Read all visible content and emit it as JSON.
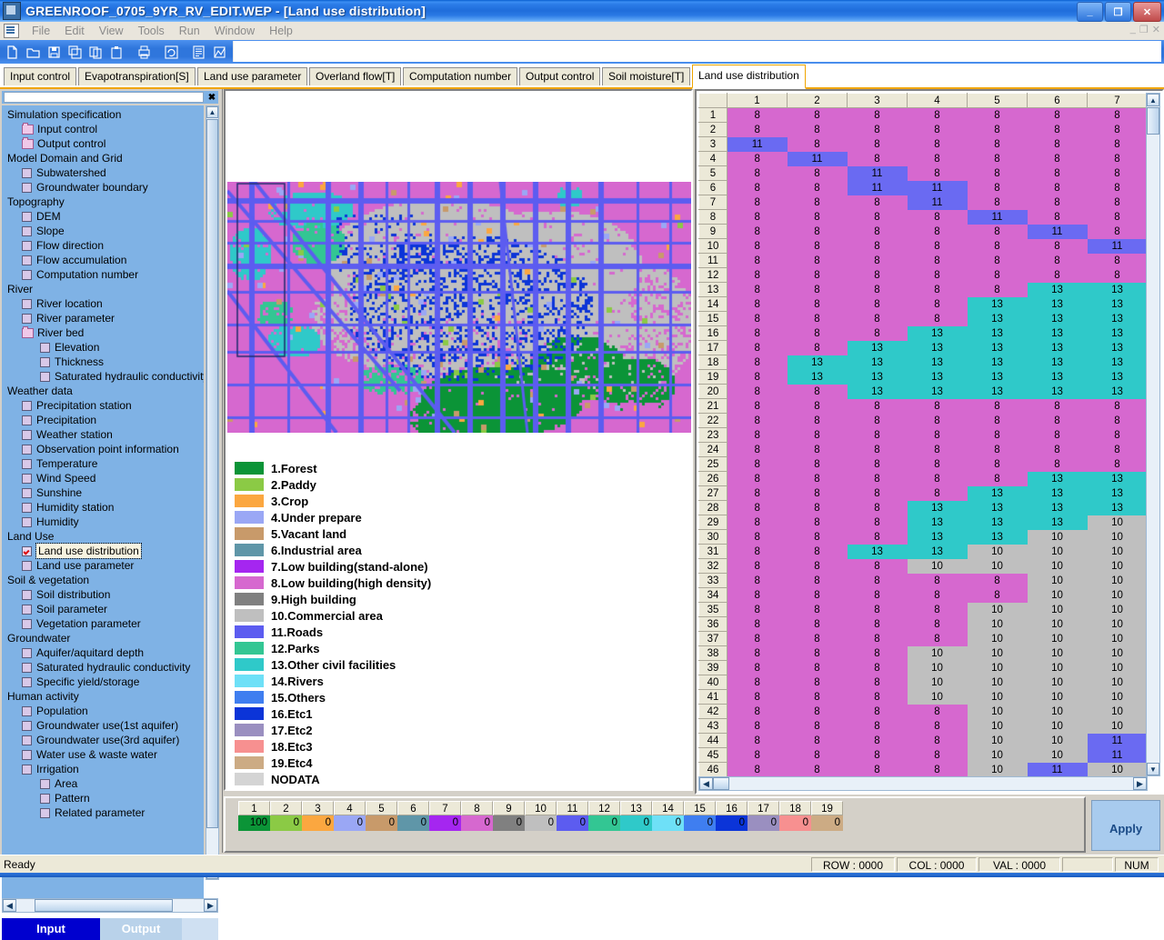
{
  "window": {
    "title": "GREENROOF_0705_9YR_RV_EDIT.WEP - [Land use distribution]",
    "minimize": "_",
    "maximize": "❐",
    "close": "✕",
    "inner_minimize": "_",
    "inner_restore": "❐",
    "inner_close": "✕"
  },
  "menu": {
    "items": [
      "File",
      "Edit",
      "View",
      "Tools",
      "Run",
      "Window",
      "Help"
    ]
  },
  "toolbar": {
    "buttons": [
      "new-icon",
      "open-icon",
      "save-icon",
      "save-all-icon",
      "copy-icon",
      "paste-icon",
      "print-icon",
      "refresh-icon",
      "report-icon",
      "chart-icon",
      "edit-pencil-icon",
      "run-icon",
      "list-icon",
      "table-icon",
      "help-icon"
    ]
  },
  "tabs": {
    "items": [
      "Input control",
      "Evapotranspiration[S]",
      "Land use parameter",
      "Overland flow[T]",
      "Computation number",
      "Output control",
      "Soil moisture[T]",
      "Land use distribution"
    ],
    "active": "Land use distribution"
  },
  "sidebar": {
    "close_label": "✖",
    "tree": [
      {
        "label": "Simulation specification",
        "type": "group"
      },
      {
        "label": "Input control",
        "type": "folder"
      },
      {
        "label": "Output control",
        "type": "folder"
      },
      {
        "label": "Model Domain and Grid",
        "type": "group"
      },
      {
        "label": "Subwatershed",
        "type": "check"
      },
      {
        "label": "Groundwater boundary",
        "type": "check"
      },
      {
        "label": "Topography",
        "type": "group"
      },
      {
        "label": "DEM",
        "type": "check"
      },
      {
        "label": "Slope",
        "type": "check"
      },
      {
        "label": "Flow direction",
        "type": "check"
      },
      {
        "label": "Flow accumulation",
        "type": "check"
      },
      {
        "label": "Computation number",
        "type": "check"
      },
      {
        "label": "River",
        "type": "group"
      },
      {
        "label": "River location",
        "type": "check"
      },
      {
        "label": "River parameter",
        "type": "check"
      },
      {
        "label": "River bed",
        "type": "folder"
      },
      {
        "label": "Elevation",
        "type": "subcheck"
      },
      {
        "label": "Thickness",
        "type": "subcheck"
      },
      {
        "label": "Saturated hydraulic conductivity",
        "type": "subcheck"
      },
      {
        "label": "Weather data",
        "type": "group"
      },
      {
        "label": "Precipitation station",
        "type": "check"
      },
      {
        "label": "Precipitation",
        "type": "check"
      },
      {
        "label": "Weather station",
        "type": "check"
      },
      {
        "label": "Observation point information",
        "type": "check"
      },
      {
        "label": "Temperature",
        "type": "check"
      },
      {
        "label": "Wind Speed",
        "type": "check"
      },
      {
        "label": "Sunshine",
        "type": "check"
      },
      {
        "label": "Humidity station",
        "type": "check"
      },
      {
        "label": "Humidity",
        "type": "check"
      },
      {
        "label": "Land Use",
        "type": "group"
      },
      {
        "label": "Land use distribution",
        "type": "check",
        "checked": true,
        "selected": true
      },
      {
        "label": "Land use parameter",
        "type": "check"
      },
      {
        "label": "Soil & vegetation",
        "type": "group"
      },
      {
        "label": "Soil distribution",
        "type": "check"
      },
      {
        "label": "Soil parameter",
        "type": "check"
      },
      {
        "label": "Vegetation parameter",
        "type": "check"
      },
      {
        "label": "Groundwater",
        "type": "group"
      },
      {
        "label": "Aquifer/aquitard depth",
        "type": "check"
      },
      {
        "label": "Saturated hydraulic conductivity",
        "type": "check"
      },
      {
        "label": "Specific yield/storage",
        "type": "check"
      },
      {
        "label": "Human activity",
        "type": "group"
      },
      {
        "label": "Population",
        "type": "check"
      },
      {
        "label": "Groundwater use(1st aquifer)",
        "type": "check"
      },
      {
        "label": "Groundwater use(3rd aquifer)",
        "type": "check"
      },
      {
        "label": "Water use & waste water",
        "type": "check"
      },
      {
        "label": "Irrigation",
        "type": "check"
      },
      {
        "label": "Area",
        "type": "subcheck"
      },
      {
        "label": "Pattern",
        "type": "subcheck"
      },
      {
        "label": "Related parameter",
        "type": "subcheck"
      }
    ],
    "io_tabs": {
      "input": "Input",
      "output": "Output"
    }
  },
  "legend": {
    "items": [
      {
        "label": "1.Forest",
        "color": "#0b9437"
      },
      {
        "label": "2.Paddy",
        "color": "#8bca45"
      },
      {
        "label": "3.Crop",
        "color": "#fba740"
      },
      {
        "label": "4.Under prepare",
        "color": "#9aa7f5"
      },
      {
        "label": "5.Vacant land",
        "color": "#c89a6a"
      },
      {
        "label": "6.Industrial area",
        "color": "#5f96a8"
      },
      {
        "label": "7.Low building(stand-alone)",
        "color": "#a526f0"
      },
      {
        "label": "8.Low building(high density)",
        "color": "#d668cf"
      },
      {
        "label": "9.High building",
        "color": "#808080"
      },
      {
        "label": "10.Commercial area",
        "color": "#bfbfbf"
      },
      {
        "label": "11.Roads",
        "color": "#5c5cf0"
      },
      {
        "label": "12.Parks",
        "color": "#33c693"
      },
      {
        "label": "13.Other civil facilities",
        "color": "#2fc9c9"
      },
      {
        "label": "14.Rivers",
        "color": "#6ee0f7"
      },
      {
        "label": "15.Others",
        "color": "#3f7ef0"
      },
      {
        "label": "16.Etc1",
        "color": "#0b34d8"
      },
      {
        "label": "17.Etc2",
        "color": "#9a8fc0"
      },
      {
        "label": "18.Etc3",
        "color": "#f79090"
      },
      {
        "label": "19.Etc4",
        "color": "#ccab84"
      },
      {
        "label": "NODATA",
        "color": "#d4d4d4"
      }
    ]
  },
  "grid": {
    "col_headers": [
      "1",
      "2",
      "3",
      "4",
      "5",
      "6",
      "7"
    ],
    "row_headers": [
      "1",
      "2",
      "3",
      "4",
      "5",
      "6",
      "7",
      "8",
      "9",
      "10",
      "11",
      "12",
      "13",
      "14",
      "15",
      "16",
      "17",
      "18",
      "19",
      "20",
      "21",
      "22",
      "23",
      "24",
      "25",
      "26",
      "27",
      "28",
      "29",
      "30",
      "31",
      "32",
      "33",
      "34",
      "35",
      "36",
      "37",
      "38",
      "39",
      "40",
      "41",
      "42",
      "43",
      "44",
      "45",
      "46"
    ],
    "rows": [
      [
        "8",
        "8",
        "8",
        "8",
        "8",
        "8",
        "8"
      ],
      [
        "8",
        "8",
        "8",
        "8",
        "8",
        "8",
        "8"
      ],
      [
        "11",
        "8",
        "8",
        "8",
        "8",
        "8",
        "8"
      ],
      [
        "8",
        "11",
        "8",
        "8",
        "8",
        "8",
        "8"
      ],
      [
        "8",
        "8",
        "11",
        "8",
        "8",
        "8",
        "8"
      ],
      [
        "8",
        "8",
        "11",
        "11",
        "8",
        "8",
        "8"
      ],
      [
        "8",
        "8",
        "8",
        "11",
        "8",
        "8",
        "8"
      ],
      [
        "8",
        "8",
        "8",
        "8",
        "11",
        "8",
        "8"
      ],
      [
        "8",
        "8",
        "8",
        "8",
        "8",
        "11",
        "8"
      ],
      [
        "8",
        "8",
        "8",
        "8",
        "8",
        "8",
        "11"
      ],
      [
        "8",
        "8",
        "8",
        "8",
        "8",
        "8",
        "8"
      ],
      [
        "8",
        "8",
        "8",
        "8",
        "8",
        "8",
        "8"
      ],
      [
        "8",
        "8",
        "8",
        "8",
        "8",
        "13",
        "13"
      ],
      [
        "8",
        "8",
        "8",
        "8",
        "13",
        "13",
        "13"
      ],
      [
        "8",
        "8",
        "8",
        "8",
        "13",
        "13",
        "13"
      ],
      [
        "8",
        "8",
        "8",
        "13",
        "13",
        "13",
        "13"
      ],
      [
        "8",
        "8",
        "13",
        "13",
        "13",
        "13",
        "13"
      ],
      [
        "8",
        "13",
        "13",
        "13",
        "13",
        "13",
        "13"
      ],
      [
        "8",
        "13",
        "13",
        "13",
        "13",
        "13",
        "13"
      ],
      [
        "8",
        "8",
        "13",
        "13",
        "13",
        "13",
        "13"
      ],
      [
        "8",
        "8",
        "8",
        "8",
        "8",
        "8",
        "8"
      ],
      [
        "8",
        "8",
        "8",
        "8",
        "8",
        "8",
        "8"
      ],
      [
        "8",
        "8",
        "8",
        "8",
        "8",
        "8",
        "8"
      ],
      [
        "8",
        "8",
        "8",
        "8",
        "8",
        "8",
        "8"
      ],
      [
        "8",
        "8",
        "8",
        "8",
        "8",
        "8",
        "8"
      ],
      [
        "8",
        "8",
        "8",
        "8",
        "8",
        "13",
        "13"
      ],
      [
        "8",
        "8",
        "8",
        "8",
        "13",
        "13",
        "13"
      ],
      [
        "8",
        "8",
        "8",
        "13",
        "13",
        "13",
        "13"
      ],
      [
        "8",
        "8",
        "8",
        "13",
        "13",
        "13",
        "10"
      ],
      [
        "8",
        "8",
        "8",
        "13",
        "13",
        "10",
        "10"
      ],
      [
        "8",
        "8",
        "13",
        "13",
        "10",
        "10",
        "10"
      ],
      [
        "8",
        "8",
        "8",
        "10",
        "10",
        "10",
        "10"
      ],
      [
        "8",
        "8",
        "8",
        "8",
        "8",
        "10",
        "10"
      ],
      [
        "8",
        "8",
        "8",
        "8",
        "8",
        "10",
        "10"
      ],
      [
        "8",
        "8",
        "8",
        "8",
        "10",
        "10",
        "10"
      ],
      [
        "8",
        "8",
        "8",
        "8",
        "10",
        "10",
        "10"
      ],
      [
        "8",
        "8",
        "8",
        "8",
        "10",
        "10",
        "10"
      ],
      [
        "8",
        "8",
        "8",
        "10",
        "10",
        "10",
        "10"
      ],
      [
        "8",
        "8",
        "8",
        "10",
        "10",
        "10",
        "10"
      ],
      [
        "8",
        "8",
        "8",
        "10",
        "10",
        "10",
        "10"
      ],
      [
        "8",
        "8",
        "8",
        "10",
        "10",
        "10",
        "10"
      ],
      [
        "8",
        "8",
        "8",
        "8",
        "10",
        "10",
        "10"
      ],
      [
        "8",
        "8",
        "8",
        "8",
        "10",
        "10",
        "10"
      ],
      [
        "8",
        "8",
        "8",
        "8",
        "10",
        "10",
        "11"
      ],
      [
        "8",
        "8",
        "8",
        "8",
        "10",
        "10",
        "11"
      ],
      [
        "8",
        "8",
        "8",
        "8",
        "10",
        "11",
        "10"
      ]
    ],
    "value_colors": {
      "8": "#d668cf",
      "10": "#bfbfbf",
      "11": "#6a6af2",
      "13": "#2fc9c9"
    }
  },
  "palette": {
    "columns": [
      {
        "index": "1",
        "value": "100",
        "color": "#0b9437"
      },
      {
        "index": "2",
        "value": "0",
        "color": "#8bca45"
      },
      {
        "index": "3",
        "value": "0",
        "color": "#fba740"
      },
      {
        "index": "4",
        "value": "0",
        "color": "#9aa7f5"
      },
      {
        "index": "5",
        "value": "0",
        "color": "#c89a6a"
      },
      {
        "index": "6",
        "value": "0",
        "color": "#5f96a8"
      },
      {
        "index": "7",
        "value": "0",
        "color": "#a526f0"
      },
      {
        "index": "8",
        "value": "0",
        "color": "#d668cf"
      },
      {
        "index": "9",
        "value": "0",
        "color": "#808080"
      },
      {
        "index": "10",
        "value": "0",
        "color": "#bfbfbf"
      },
      {
        "index": "11",
        "value": "0",
        "color": "#5c5cf0"
      },
      {
        "index": "12",
        "value": "0",
        "color": "#33c693"
      },
      {
        "index": "13",
        "value": "0",
        "color": "#2fc9c9"
      },
      {
        "index": "14",
        "value": "0",
        "color": "#6ee0f7"
      },
      {
        "index": "15",
        "value": "0",
        "color": "#3f7ef0"
      },
      {
        "index": "16",
        "value": "0",
        "color": "#0b34d8"
      },
      {
        "index": "17",
        "value": "0",
        "color": "#9a8fc0"
      },
      {
        "index": "18",
        "value": "0",
        "color": "#f79090"
      },
      {
        "index": "19",
        "value": "0",
        "color": "#ccab84"
      }
    ],
    "apply_label": "Apply"
  },
  "status": {
    "ready": "Ready",
    "row": "ROW : 0000",
    "col": "COL : 0000",
    "val": "VAL : 0000",
    "num": "NUM"
  }
}
